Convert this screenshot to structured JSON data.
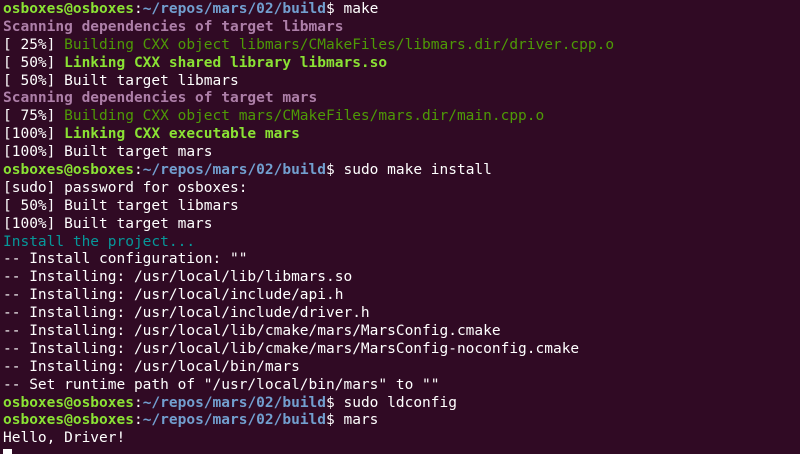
{
  "terminal": {
    "colors": {
      "background": "#300a24",
      "text": "#ffffff",
      "prompt_user": "#8ae234",
      "prompt_path": "#729fcf",
      "scanning": "#ad7fa8",
      "building": "#4e9a06",
      "linking": "#8ae234",
      "install_header": "#06989a"
    },
    "prompt": {
      "user": "osboxes@osboxes",
      "sep": ":",
      "path": "~/repos/mars/02/build",
      "symbol": "$ "
    },
    "lines": [
      {
        "type": "prompt",
        "cmd": "make"
      },
      {
        "type": "scan",
        "text": "Scanning dependencies of target libmars"
      },
      {
        "type": "build",
        "prefix": "[ 25%] ",
        "text": "Building CXX object libmars/CMakeFiles/libmars.dir/driver.cpp.o"
      },
      {
        "type": "link",
        "prefix": "[ 50%] ",
        "text": "Linking CXX shared library libmars.so"
      },
      {
        "type": "plain",
        "text": "[ 50%] Built target libmars"
      },
      {
        "type": "scan",
        "text": "Scanning dependencies of target mars"
      },
      {
        "type": "build",
        "prefix": "[ 75%] ",
        "text": "Building CXX object mars/CMakeFiles/mars.dir/main.cpp.o"
      },
      {
        "type": "link",
        "prefix": "[100%] ",
        "text": "Linking CXX executable mars"
      },
      {
        "type": "plain",
        "text": "[100%] Built target mars"
      },
      {
        "type": "prompt",
        "cmd": "sudo make install"
      },
      {
        "type": "plain",
        "text": "[sudo] password for osboxes:"
      },
      {
        "type": "plain",
        "text": "[ 50%] Built target libmars"
      },
      {
        "type": "plain",
        "text": "[100%] Built target mars"
      },
      {
        "type": "install",
        "text": "Install the project..."
      },
      {
        "type": "plain",
        "text": "-- Install configuration: \"\""
      },
      {
        "type": "plain",
        "text": "-- Installing: /usr/local/lib/libmars.so"
      },
      {
        "type": "plain",
        "text": "-- Installing: /usr/local/include/api.h"
      },
      {
        "type": "plain",
        "text": "-- Installing: /usr/local/include/driver.h"
      },
      {
        "type": "plain",
        "text": "-- Installing: /usr/local/lib/cmake/mars/MarsConfig.cmake"
      },
      {
        "type": "plain",
        "text": "-- Installing: /usr/local/lib/cmake/mars/MarsConfig-noconfig.cmake"
      },
      {
        "type": "plain",
        "text": "-- Installing: /usr/local/bin/mars"
      },
      {
        "type": "plain",
        "text": "-- Set runtime path of \"/usr/local/bin/mars\" to \"\""
      },
      {
        "type": "prompt",
        "cmd": "sudo ldconfig"
      },
      {
        "type": "prompt",
        "cmd": "mars"
      },
      {
        "type": "plain",
        "text": "Hello, Driver!"
      },
      {
        "type": "cursor"
      }
    ]
  }
}
